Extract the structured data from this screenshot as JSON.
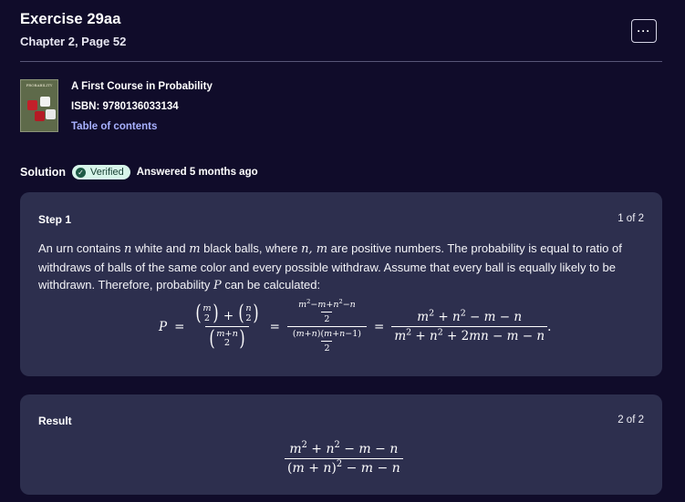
{
  "header": {
    "title": "Exercise 29aa",
    "subtitle": "Chapter 2, Page 52",
    "more_label": "···"
  },
  "book": {
    "title": "A First Course in Probability",
    "isbn": "ISBN: 9780136033134",
    "toc": "Table of contents",
    "cover_text": "PROBABILITY"
  },
  "solution": {
    "label": "Solution",
    "verified": "Verified",
    "answered": "Answered 5 months ago"
  },
  "steps": [
    {
      "label": "Step 1",
      "count": "1 of 2",
      "text_a": "An urn contains ",
      "var_n": "n",
      "text_b": " white and ",
      "var_m": "m",
      "text_c": " black balls, where ",
      "vars_nm": "n, m",
      "text_d": " are positive numbers. The probability is equal to ratio of withdraws of balls of the same color and every possible withdraw. Assume that every ball is equally likely to be withdrawn. Therefore, probability ",
      "var_p": "P",
      "text_e": " can be calculated:"
    },
    {
      "label": "Result",
      "count": "2 of 2"
    }
  ],
  "colors": {
    "background": "#100c2a",
    "card": "#2d2f4e",
    "link": "#a8b1ff",
    "verified_bg": "#d7f5ea"
  }
}
